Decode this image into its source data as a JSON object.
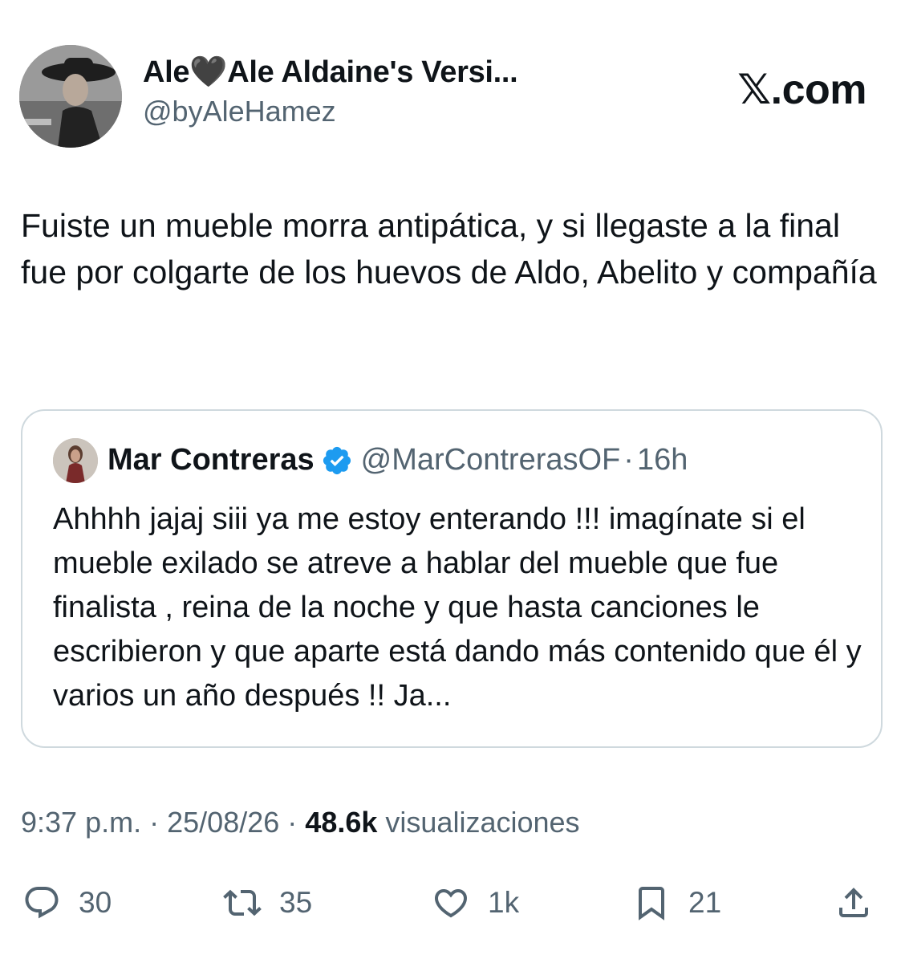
{
  "author": {
    "display_name": "Ale🖤Ale Aldaine's Versi...",
    "handle": "@byAleHamez"
  },
  "brand": {
    "label": "𝕏.com"
  },
  "tweet": {
    "text": "Fuiste un mueble morra antipática, y si llegaste a la final fue por colgarte de los huevos de Aldo, Abelito y compañía"
  },
  "quoted_tweet": {
    "name": "Mar Contreras",
    "handle": "@MarContrerasOF",
    "separator": "·",
    "age": "16h",
    "verified": true,
    "text": "Ahhhh jajaj siii ya me estoy enterando !!!  imagínate si el mueble exilado se atreve a hablar del mueble que fue finalista , reina de la noche y que hasta canciones le escribieron y que aparte está dando más contenido que él y varios un año después !! Ja..."
  },
  "meta": {
    "time": "9:37 p.m.",
    "separator": "·",
    "date": "25/08/26",
    "views_count": "48.6k",
    "views_label": "visualizaciones"
  },
  "actions": {
    "replies": "30",
    "reposts": "35",
    "likes": "1k",
    "bookmarks": "21"
  },
  "icons": [
    "avatar",
    "verified-badge-icon",
    "reply-icon",
    "repost-icon",
    "like-icon",
    "bookmark-icon",
    "share-icon"
  ],
  "colors": {
    "text": "#0f1419",
    "secondary": "#536471",
    "border": "#cfd9de",
    "verified": "#1d9bf0"
  }
}
